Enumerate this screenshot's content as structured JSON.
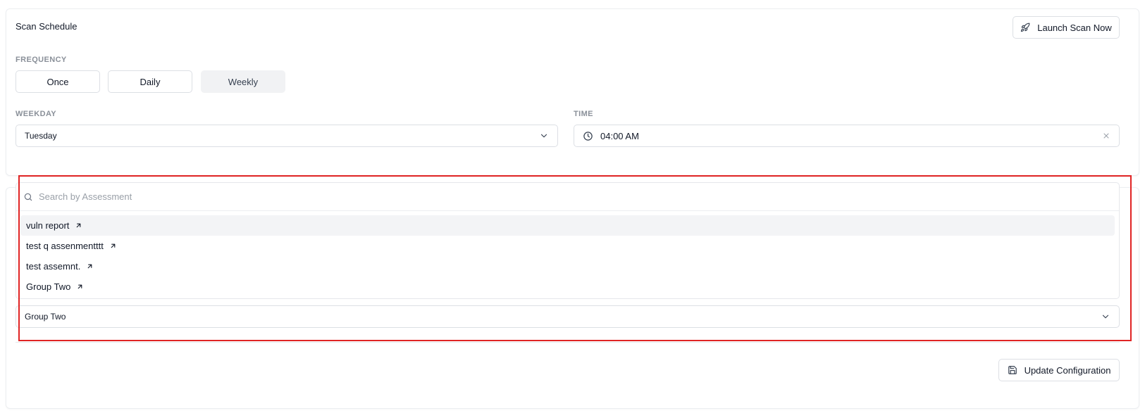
{
  "schedule": {
    "title": "Scan Schedule",
    "launch_label": "Launch Scan Now",
    "frequency_label": "FREQUENCY",
    "frequency_options": [
      "Once",
      "Daily",
      "Weekly"
    ],
    "frequency_selected": "Weekly",
    "weekday_label": "WEEKDAY",
    "weekday_value": "Tuesday",
    "time_label": "TIME",
    "time_value": "04:00 AM"
  },
  "assessment": {
    "search_placeholder": "Search by Assessment",
    "options": [
      {
        "label": "vuln report",
        "active": true
      },
      {
        "label": "test q assenmentttt",
        "active": false
      },
      {
        "label": "test assemnt.",
        "active": false
      },
      {
        "label": "Group Two",
        "active": false
      }
    ],
    "selected": "Group Two"
  },
  "footer": {
    "update_label": "Update Configuration"
  },
  "icons": {
    "launch": "rocket-icon",
    "chevron": "chevron-down-icon",
    "time": "clock-icon",
    "clear": "close-icon",
    "search": "search-icon",
    "external": "arrow-up-right-icon",
    "save": "save-icon"
  },
  "colors": {
    "highlight": "#e02424",
    "selected_bg": "#f1f2f4"
  }
}
